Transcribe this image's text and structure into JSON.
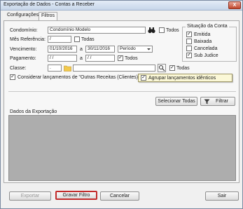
{
  "window": {
    "title": "Exportação de Dados - Contas a Receber",
    "close_glyph": "X"
  },
  "tabs": [
    {
      "label": "Configurações"
    },
    {
      "label": "Filtros"
    }
  ],
  "form": {
    "condominio": {
      "label": "Condomínio:",
      "value": "Condomínio Modelo",
      "todos_label": "Todos",
      "todos_checked": false
    },
    "mes_referencia": {
      "label": "Mês Referência:",
      "value": "/",
      "todos_label": "Todas",
      "todos_checked": false
    },
    "vencimento": {
      "label": "Vencimento:",
      "from": "01/10/2016",
      "a_label": "a",
      "to": "30/11/2016",
      "mode": "Período"
    },
    "pagamento": {
      "label": "Pagamento:",
      "from": "/ /",
      "a_label": "a",
      "to": "/ /",
      "todos_label": "Todos",
      "todos_checked": true
    },
    "classe": {
      "label": "Classe:",
      "code": ".",
      "value": "",
      "todas_label": "Todas",
      "todas_checked": true
    },
    "considerar": {
      "label": "Considerar lançamentos de \"Outras Receitas (Clientes)\"",
      "checked": true
    },
    "agrupar": {
      "label": "Agrupar lançamentos idênticos",
      "checked": true
    }
  },
  "situacao": {
    "legend": "Situação da Conta",
    "items": [
      {
        "label": "Emitida",
        "checked": true
      },
      {
        "label": "Baixada",
        "checked": false
      },
      {
        "label": "Cancelada",
        "checked": false
      },
      {
        "label": "Sub Judice",
        "checked": true
      }
    ]
  },
  "actions": {
    "selecionar_todas": "Selecionar Todas",
    "filtrar": "Filtrar"
  },
  "dados": {
    "legend": "Dados da Exportação"
  },
  "footer": {
    "exportar": "Exportar",
    "gravar_filtro": "Gravar Filtro",
    "cancelar": "Cancelar",
    "sair": "Sair"
  },
  "colors": {
    "highlight_border": "#c22b2b",
    "tooltip_bg": "#fbf8d7",
    "title_gradient_top": "#e3ecf7"
  }
}
